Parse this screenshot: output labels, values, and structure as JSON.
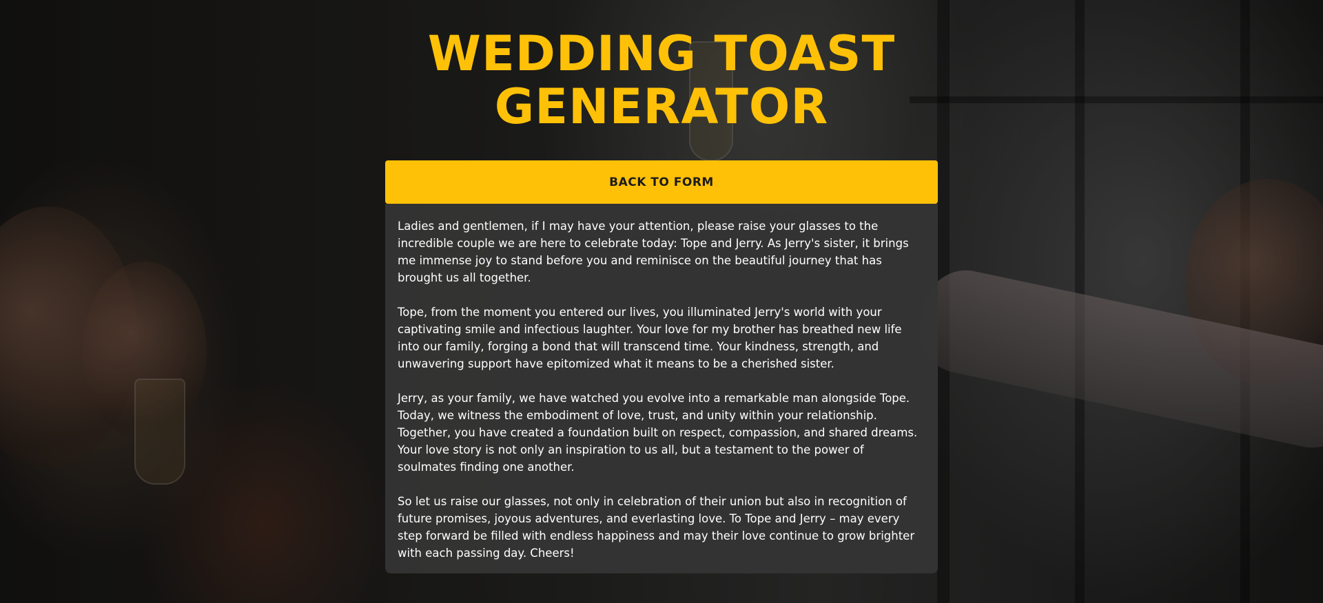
{
  "page": {
    "title_line1": "WEDDING TOAST",
    "title_line2": "GENERATOR"
  },
  "actions": {
    "back_label": "BACK TO FORM"
  },
  "toast": {
    "paragraphs": [
      "Ladies and gentlemen, if I may have your attention, please raise your glasses to the incredible couple we are here to celebrate today: Tope and Jerry. As Jerry's sister, it brings me immense joy to stand before you and reminisce on the beautiful journey that has brought us all together.",
      "Tope, from the moment you entered our lives, you illuminated Jerry's world with your captivating smile and infectious laughter. Your love for my brother has breathed new life into our family, forging a bond that will transcend time. Your kindness, strength, and unwavering support have epitomized what it means to be a cherished sister.",
      "Jerry, as your family, we have watched you evolve into a remarkable man alongside Tope. Today, we witness the embodiment of love, trust, and unity within your relationship. Together, you have created a foundation built on respect, compassion, and shared dreams. Your love story is not only an inspiration to us all, but a testament to the power of soulmates finding one another.",
      "So let us raise our glasses, not only in celebration of their union but also in recognition of future promises, joyous adventures, and everlasting love. To Tope and Jerry – may every step forward be filled with endless happiness and may their love continue to grow brighter with each passing day. Cheers!"
    ]
  },
  "colors": {
    "accent": "#FFC107",
    "card_background": "#343434",
    "text": "#FFFFFF"
  }
}
